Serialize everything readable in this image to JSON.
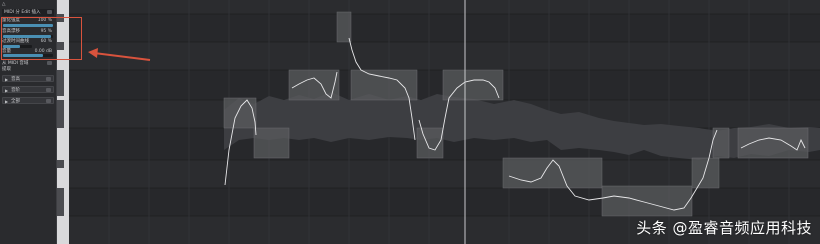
{
  "inspector": {
    "header_label": "△",
    "module_label": "MIDI 分 Edit 插入",
    "params": [
      {
        "label": "量化强度",
        "value": "100 %",
        "fill": 1.0
      },
      {
        "label": "音高漂移",
        "value": "95 %",
        "fill": 0.95
      },
      {
        "label": "过渡时间曲线",
        "value": "60 %",
        "fill": 0.6
      },
      {
        "label": "音量",
        "value": "0.00 dB",
        "fill": 0.8
      }
    ],
    "midi_label": "从 MIDI 音域",
    "extract_label": "提取",
    "sections": [
      {
        "label": "音高"
      },
      {
        "label": "音阶"
      },
      {
        "label": "全部"
      }
    ]
  },
  "watermark": "头条 @盈睿音频应用科技",
  "colors": {
    "background": "#27282b",
    "inspector": "#2a2b2e",
    "note_block": "#5a5b5e",
    "pitch_curve": "#e8e8ea",
    "annotation": "#d9533d",
    "playhead": "#c8c9cc"
  }
}
